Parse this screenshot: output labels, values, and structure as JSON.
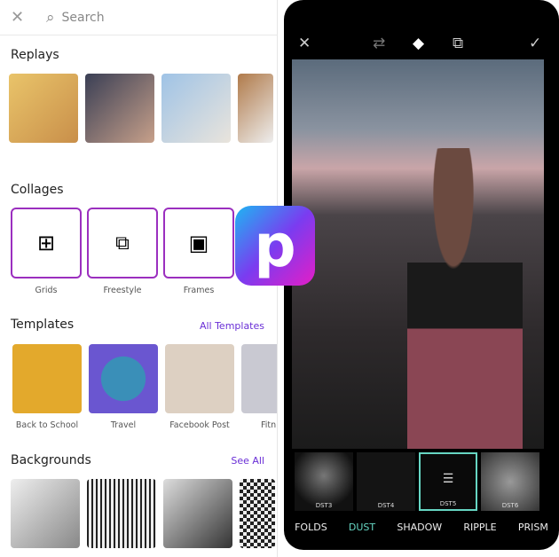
{
  "search": {
    "placeholder": "Search"
  },
  "replays": {
    "title": "Replays"
  },
  "collages": {
    "title": "Collages",
    "items": [
      {
        "label": "Grids"
      },
      {
        "label": "Freestyle"
      },
      {
        "label": "Frames"
      }
    ]
  },
  "templates": {
    "title": "Templates",
    "link": "All Templates",
    "items": [
      {
        "label": "Back to School"
      },
      {
        "label": "Travel"
      },
      {
        "label": "Facebook Post"
      },
      {
        "label": "Fitn"
      }
    ]
  },
  "backgrounds": {
    "title": "Backgrounds",
    "link": "See All"
  },
  "logo": {
    "letter": "p"
  },
  "editor": {
    "filters": [
      {
        "label": "DST3"
      },
      {
        "label": "DST4"
      },
      {
        "label": "DST5"
      },
      {
        "label": "DST6"
      }
    ],
    "categories": [
      "FOLDS",
      "DUST",
      "SHADOW",
      "RIPPLE",
      "PRISM"
    ],
    "active_category": "DUST",
    "accent": "#66d6c3"
  }
}
